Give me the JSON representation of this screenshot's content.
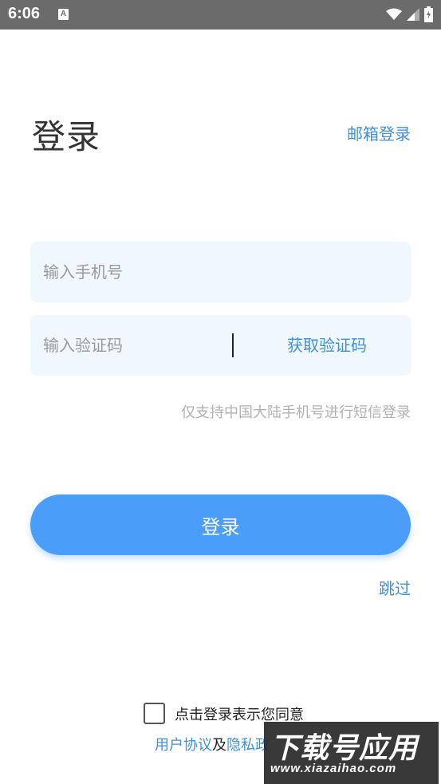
{
  "status_bar": {
    "time": "6:06",
    "notification_letter": "A",
    "background_color": "#6b6b6b"
  },
  "header": {
    "title": "登录",
    "email_login_link": "邮箱登录"
  },
  "phone_field": {
    "placeholder": "输入手机号",
    "value": ""
  },
  "code_field": {
    "placeholder": "输入验证码",
    "value": "",
    "get_code_button": "获取验证码"
  },
  "hint_text": "仅支持中国大陆手机号进行短信登录",
  "login_button": "登录",
  "skip_link": "跳过",
  "agreement": {
    "checkbox_checked": false,
    "text": "点击登录表示您同意",
    "user_agreement_link": "用户协议",
    "conjunction": "及",
    "privacy_policy_link": "隐私政"
  },
  "watermark": {
    "logo": "下载号应用",
    "url": "www.xiazaihao.com"
  },
  "colors": {
    "accent": "#3d8fe0",
    "button": "#4a9ef9",
    "field_background": "#f1f8fd",
    "hint": "#b2b2b2"
  }
}
